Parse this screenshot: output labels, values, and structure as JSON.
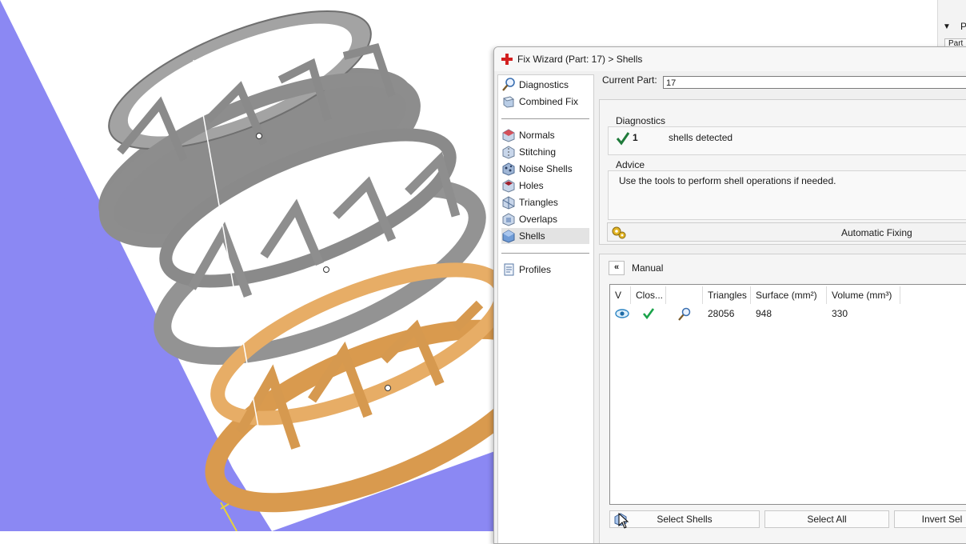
{
  "window": {
    "title": "Fix Wizard (Part: 17) > Shells"
  },
  "right_panel": {
    "label": "Pa",
    "tab": "Part"
  },
  "nav": {
    "items_top": [
      {
        "label": "Diagnostics",
        "icon": "magnifier-icon"
      },
      {
        "label": "Combined Fix",
        "icon": "combined-fix-icon"
      }
    ],
    "items_tools": [
      {
        "label": "Normals",
        "icon": "normals-icon"
      },
      {
        "label": "Stitching",
        "icon": "stitching-icon"
      },
      {
        "label": "Noise Shells",
        "icon": "noise-shells-icon"
      },
      {
        "label": "Holes",
        "icon": "holes-icon"
      },
      {
        "label": "Triangles",
        "icon": "triangles-icon"
      },
      {
        "label": "Overlaps",
        "icon": "overlaps-icon"
      },
      {
        "label": "Shells",
        "icon": "shells-icon",
        "selected": true
      }
    ],
    "items_bottom": [
      {
        "label": "Profiles",
        "icon": "profiles-icon"
      }
    ]
  },
  "current_part": {
    "label": "Current Part:",
    "value": "17"
  },
  "diagnostics": {
    "title": "Diagnostics",
    "count": "1",
    "text": "shells detected"
  },
  "advice": {
    "title": "Advice",
    "text": "Use the tools to perform shell operations if needed."
  },
  "automatic_fixing": {
    "label": "Automatic Fixing"
  },
  "manual": {
    "toggle": "«",
    "label": "Manual",
    "columns": [
      "V",
      "Clos...",
      "",
      "Triangles",
      "Surface (mm²)",
      "Volume (mm³)"
    ],
    "rows": [
      {
        "visible": "eye-icon",
        "closed": "check-icon",
        "tool": "magnifier-icon",
        "triangles": "28056",
        "surface": "948",
        "volume": "330"
      }
    ]
  },
  "buttons": {
    "select_shells": "Select Shells",
    "select_all": "Select All",
    "invert_sel": "Invert Sel"
  },
  "colors": {
    "viewport_plane": "#8a86f2",
    "ring_gray": "#9a9a9a",
    "ring_orange": "#e0a45a",
    "check_green": "#1aa34a"
  }
}
